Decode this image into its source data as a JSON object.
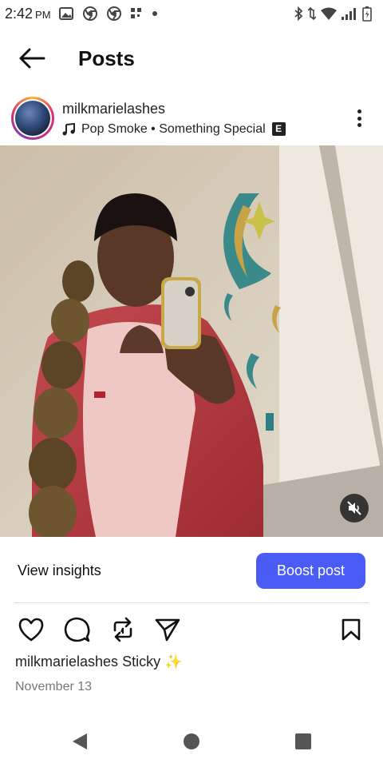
{
  "status_bar": {
    "time": "2:42",
    "ampm": "PM",
    "icons": [
      "image-notification-icon",
      "chrome-icon",
      "chrome-icon",
      "app-grid-icon",
      "dot-icon",
      "bluetooth-icon",
      "data-arrows-icon",
      "wifi-icon",
      "signal-icon",
      "battery-charging-icon"
    ]
  },
  "header": {
    "title": "Posts",
    "back_icon": "arrow-left-icon"
  },
  "post": {
    "username": "milkmarielashes",
    "music_artist": "Pop Smoke",
    "music_separator": "•",
    "music_title": "Something Special",
    "explicit_badge": "E",
    "more_icon": "vertical-dots-icon",
    "media_description_icon": "mute-icon",
    "caption_user": "milkmarielashes",
    "caption_text": "Sticky ✨",
    "date": "November 13"
  },
  "insights": {
    "view_label": "View insights",
    "boost_label": "Boost post"
  },
  "colors": {
    "boost_button": "#4a5cf5",
    "text_primary": "#111111",
    "text_secondary": "#777777"
  },
  "actions": [
    "heart-icon",
    "comment-icon",
    "repost-icon",
    "share-icon",
    "bookmark-icon"
  ],
  "nav": [
    "back-triangle-icon",
    "home-circle-icon",
    "recents-square-icon"
  ]
}
